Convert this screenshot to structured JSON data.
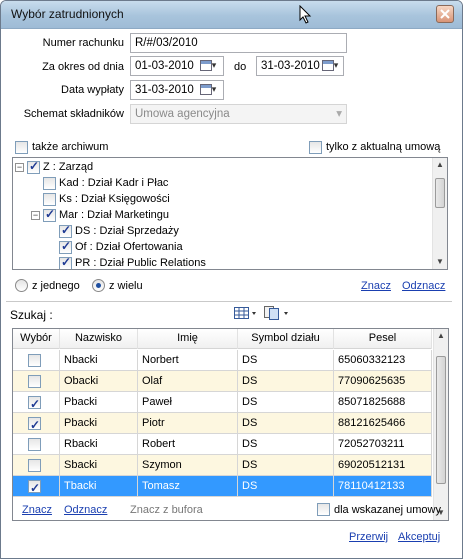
{
  "window": {
    "title": "Wybór zatrudnionych"
  },
  "form": {
    "account_label": "Numer rachunku",
    "account_value": "R/#/03/2010",
    "period_label": "Za okres od dnia",
    "period_from": "01-03-2010",
    "period_to_label": "do",
    "period_to": "31-03-2010",
    "payout_label": "Data wypłaty",
    "payout_value": "31-03-2010",
    "scheme_label": "Schemat składników",
    "scheme_value": "Umowa agencyjna"
  },
  "filters": {
    "archive_label": "także archiwum",
    "archive_checked": false,
    "current_contract_label": "tylko z aktualną umową",
    "current_contract_checked": false
  },
  "tree": [
    {
      "label": "Z : Zarząd",
      "checked": true,
      "level": 0,
      "expander": "−"
    },
    {
      "label": "Kad : Dział Kadr i Płac",
      "checked": false,
      "level": 1,
      "expander": ""
    },
    {
      "label": "Ks : Dział Księgowości",
      "checked": false,
      "level": 1,
      "expander": ""
    },
    {
      "label": "Mar : Dział Marketingu",
      "checked": true,
      "level": 1,
      "expander": "−"
    },
    {
      "label": "DS : Dział Sprzedaży",
      "checked": true,
      "level": 2,
      "expander": ""
    },
    {
      "label": "Of : Dział Ofertowania",
      "checked": true,
      "level": 2,
      "expander": ""
    },
    {
      "label": "PR : Dział Public Relations",
      "checked": true,
      "level": 2,
      "expander": ""
    }
  ],
  "mode": {
    "single_label": "z jednego",
    "multi_label": "z wielu",
    "selected": "multi",
    "mark_label": "Znacz",
    "unmark_label": "Odznacz"
  },
  "search": {
    "label": "Szukaj :",
    "value": ""
  },
  "grid": {
    "columns": [
      "Wybór",
      "Nazwisko",
      "Imię",
      "Symbol działu",
      "Pesel"
    ],
    "rows": [
      {
        "checked": false,
        "surname": "Nbacki",
        "name": "Norbert",
        "dept": "DS",
        "pesel": "65060332123"
      },
      {
        "checked": false,
        "surname": "Obacki",
        "name": "Olaf",
        "dept": "DS",
        "pesel": "77090625635"
      },
      {
        "checked": true,
        "surname": "Pbacki",
        "name": "Paweł",
        "dept": "DS",
        "pesel": "85071825688"
      },
      {
        "checked": true,
        "surname": "Pbacki",
        "name": "Piotr",
        "dept": "DS",
        "pesel": "88121625466"
      },
      {
        "checked": false,
        "surname": "Rbacki",
        "name": "Robert",
        "dept": "DS",
        "pesel": "72052703211"
      },
      {
        "checked": false,
        "surname": "Sbacki",
        "name": "Szymon",
        "dept": "DS",
        "pesel": "69020512131"
      },
      {
        "checked": true,
        "surname": "Tbacki",
        "name": "Tomasz",
        "dept": "DS",
        "pesel": "78110412133",
        "selected": true
      }
    ]
  },
  "footer": {
    "mark_label": "Znacz",
    "unmark_label": "Odznacz",
    "mark_buffer_label": "Znacz z bufora",
    "selected_contract_label": "dla wskazanej umowy",
    "selected_contract_checked": false,
    "cancel_label": "Przerwij",
    "accept_label": "Akceptuj"
  },
  "colors": {
    "selection": "#3399ff",
    "row_alt": "#fdf7e0",
    "link": "#1a3fb0"
  }
}
